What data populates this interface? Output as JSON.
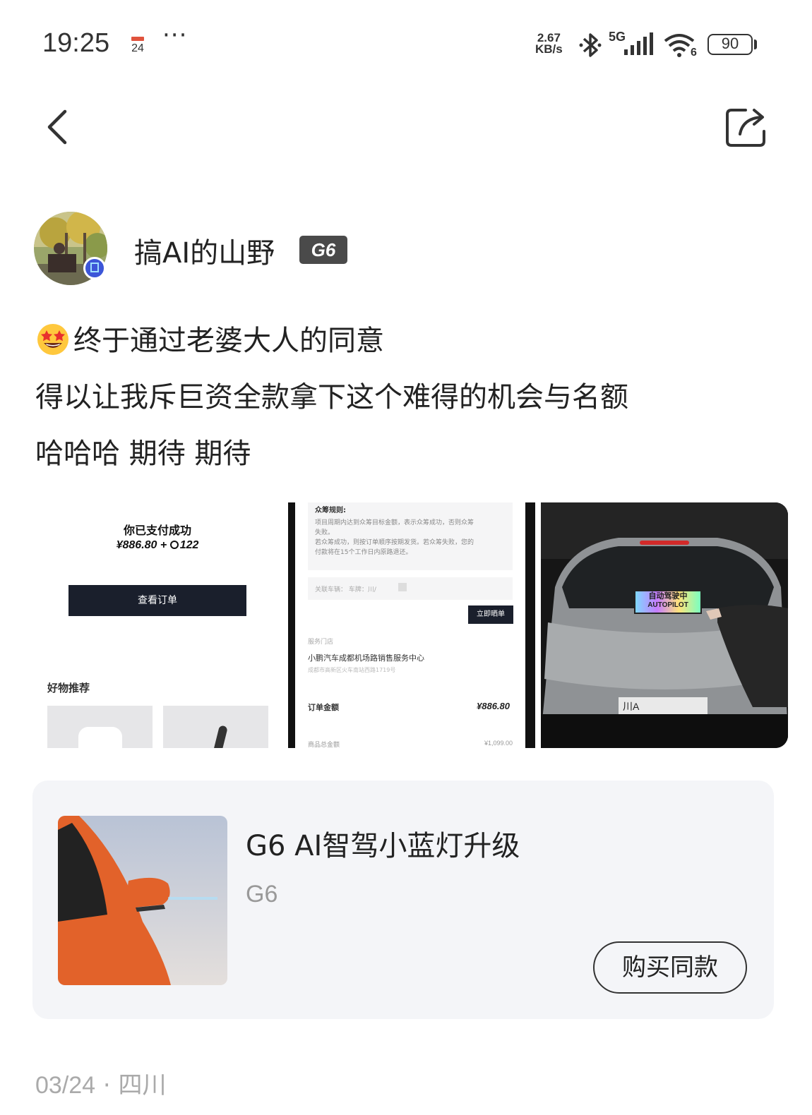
{
  "status_bar": {
    "time": "19:25",
    "calendar_day": "24",
    "more": "···",
    "speed_value": "2.67",
    "speed_unit": "KB/s",
    "network": "5G",
    "wifi_badge": "6",
    "battery": "90"
  },
  "nav": {
    "back_icon": "chevron-left-icon",
    "share_icon": "share-icon"
  },
  "author": {
    "name": "搞AI的山野",
    "model_badge": "G6"
  },
  "post": {
    "lines": [
      "终于通过老婆大人的同意",
      "得以让我斥巨资全款拿下这个难得的机会与名额",
      "哈哈哈 期待 期待"
    ]
  },
  "images": {
    "payment": {
      "title": "你已支付成功",
      "amount": "¥886.80 + ",
      "points": "122",
      "button": "查看订单",
      "section": "好物推荐"
    },
    "order": {
      "rules_title": "众筹规则:",
      "rules_text_1": "项目周期内达到众筹目标金额，表示众筹成功，否则众筹",
      "rules_text_2": "失败。",
      "rules_text_3": "若众筹成功，则按订单顺序按期发货。若众筹失败，您的",
      "rules_text_4": "付款将在15个工作日内原路退还。",
      "vehicle_label": "关联车辆：  车牌：川/",
      "bind_button": "立即晒单",
      "store_label": "服务门店",
      "store_name": "小鹏汽车成都机场路销售服务中心",
      "store_addr": "成都市高新区火车南站西路1719号",
      "total_label": "订单金额",
      "total_value": "¥886.80",
      "goods_label": "商品总金额",
      "goods_value": "¥1,099.00"
    },
    "car": {
      "sign_cn": "自动驾驶中",
      "sign_en": "AUTOPILOT",
      "plate": "川A"
    }
  },
  "product": {
    "title": "G6 AI智驾小蓝灯升级",
    "subtitle": "G6",
    "button": "购买同款"
  },
  "meta": {
    "date": "03/24",
    "separator": " · ",
    "location": "四川"
  }
}
